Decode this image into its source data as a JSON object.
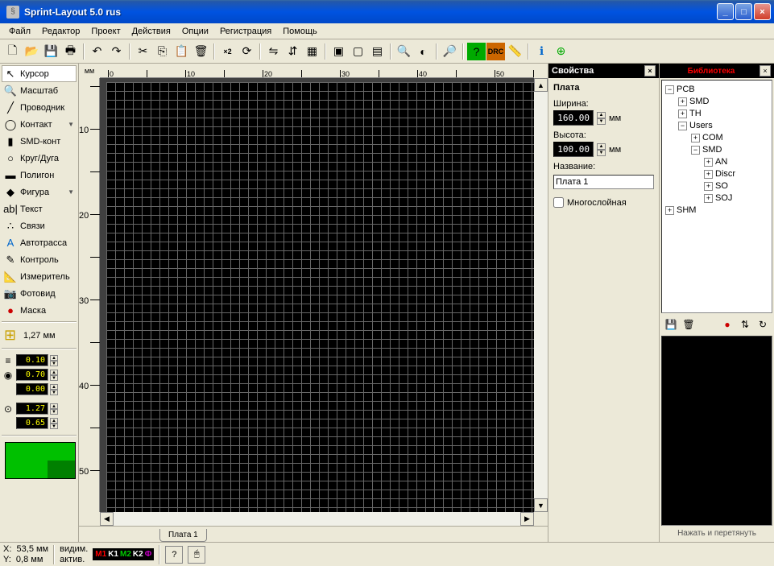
{
  "window": {
    "title": "Sprint-Layout 5.0 rus"
  },
  "menu": [
    "Файл",
    "Редактор",
    "Проект",
    "Действия",
    "Опции",
    "Регистрация",
    "Помощь"
  ],
  "toolbar": [
    {
      "name": "new-icon",
      "glyph": "🗋"
    },
    {
      "name": "open-icon",
      "glyph": "📂"
    },
    {
      "name": "save-icon",
      "glyph": "💾"
    },
    {
      "name": "print-icon",
      "glyph": "🖶"
    },
    {
      "sep": true
    },
    {
      "name": "undo-icon",
      "glyph": "↶"
    },
    {
      "name": "redo-icon",
      "glyph": "↷"
    },
    {
      "sep": true
    },
    {
      "name": "cut-icon",
      "glyph": "✂"
    },
    {
      "name": "copy-icon",
      "glyph": "⎘"
    },
    {
      "name": "paste-icon",
      "glyph": "📋"
    },
    {
      "name": "delete-icon",
      "glyph": "🗑"
    },
    {
      "sep": true
    },
    {
      "name": "duplicate-icon",
      "glyph": "×2"
    },
    {
      "name": "rotate-icon",
      "glyph": "⟳"
    },
    {
      "sep": true
    },
    {
      "name": "mirror-h-icon",
      "glyph": "⇋"
    },
    {
      "name": "mirror-v-icon",
      "glyph": "⇵"
    },
    {
      "name": "align-icon",
      "glyph": "▦"
    },
    {
      "sep": true
    },
    {
      "name": "group-icon",
      "glyph": "▣"
    },
    {
      "name": "ungroup-icon",
      "glyph": "▢"
    },
    {
      "name": "tile-icon",
      "glyph": "▤"
    },
    {
      "sep": true
    },
    {
      "name": "zoom-icon",
      "glyph": "🔍"
    },
    {
      "name": "contrast-icon",
      "glyph": "◐"
    },
    {
      "sep": true
    },
    {
      "name": "scan-icon",
      "glyph": "🔎"
    },
    {
      "sep": true
    },
    {
      "name": "help-icon",
      "glyph": "?",
      "bg": "#0a0"
    },
    {
      "name": "drc-icon",
      "glyph": "DRC",
      "bg": "#c60"
    },
    {
      "name": "measure-tool-icon",
      "glyph": "📏"
    },
    {
      "sep": true
    },
    {
      "name": "info-icon",
      "glyph": "ℹ",
      "color": "#06c"
    },
    {
      "name": "component-icon",
      "glyph": "⊕",
      "color": "#0a0"
    }
  ],
  "tools": [
    {
      "name": "cursor-tool",
      "icon": "↖",
      "label": "Курсор",
      "selected": true
    },
    {
      "name": "zoom-tool",
      "icon": "🔍",
      "label": "Масштаб"
    },
    {
      "name": "track-tool",
      "icon": "╱",
      "label": "Проводник"
    },
    {
      "name": "pad-tool",
      "icon": "◯",
      "label": "Контакт",
      "dropdown": true
    },
    {
      "name": "smd-tool",
      "icon": "▮",
      "label": "SMD-конт"
    },
    {
      "name": "circle-tool",
      "icon": "○",
      "label": "Круг/Дуга"
    },
    {
      "name": "polygon-tool",
      "icon": "▬",
      "label": "Полигон"
    },
    {
      "name": "shape-tool",
      "icon": "◆",
      "label": "Фигура",
      "dropdown": true
    },
    {
      "name": "text-tool",
      "icon": "ab|",
      "label": "Текст"
    },
    {
      "name": "connection-tool",
      "icon": "∴",
      "label": "Связи"
    },
    {
      "name": "autoroute-tool",
      "icon": "A",
      "label": "Автотрасса",
      "color": "#06c"
    },
    {
      "name": "inspect-tool",
      "icon": "✎",
      "label": "Контроль"
    },
    {
      "name": "ruler-tool",
      "icon": "📐",
      "label": "Измеритель"
    },
    {
      "name": "photoview-tool",
      "icon": "📷",
      "label": "Фотовид"
    },
    {
      "name": "mask-tool",
      "icon": "●",
      "label": "Маска",
      "color": "#c00"
    }
  ],
  "grid": {
    "label": "1,27 мм"
  },
  "params": {
    "track_width": "0.10",
    "pad_outer": "0.70",
    "pad_inner": "0.00",
    "via_a": "1.27",
    "via_b": "0.65"
  },
  "ruler": {
    "unit": "мм",
    "h_ticks": [
      "0",
      "",
      "10",
      "",
      "20",
      "",
      "30",
      "",
      "40",
      "",
      "50",
      ""
    ],
    "v_ticks": [
      "",
      "10",
      "",
      "20",
      "",
      "30",
      "",
      "40",
      "",
      "50"
    ]
  },
  "tabs": {
    "board1": "Плата 1"
  },
  "properties": {
    "panel_title": "Свойства",
    "heading": "Плата",
    "width_label": "Ширина:",
    "width_value": "160.00",
    "height_label": "Высота:",
    "height_value": "100.00",
    "unit": "мм",
    "name_label": "Название:",
    "name_value": "Плата 1",
    "multilayer_label": "Многослойная"
  },
  "library": {
    "panel_title": "Библиотека",
    "tree": {
      "PCB": {
        "exp": true,
        "children": {
          "SMD": {
            "exp": false
          },
          "TH": {
            "exp": false
          },
          "Users": {
            "exp": true,
            "children": {
              "COM": {
                "exp": false
              },
              "SMD": {
                "exp": true,
                "children": {
                  "AN": {},
                  "Discr": {},
                  "SO": {},
                  "SOJ": {}
                }
              }
            }
          }
        }
      },
      "SHM": {
        "exp": false
      }
    },
    "toolbar": [
      {
        "name": "lib-save-icon",
        "glyph": "💾"
      },
      {
        "name": "lib-delete-icon",
        "glyph": "🗑"
      },
      {
        "name": "lib-record-icon",
        "glyph": "●",
        "color": "#c00"
      },
      {
        "name": "lib-sort-icon",
        "glyph": "⇅"
      },
      {
        "name": "lib-refresh-icon",
        "glyph": "↻"
      }
    ],
    "hint": "Нажать и перетянуть"
  },
  "status": {
    "x_label": "X:",
    "x_value": "53,5 мм",
    "y_label": "Y:",
    "y_value": "0,8 мм",
    "visible_label": "видим.",
    "active_label": "актив.",
    "layers": [
      {
        "name": "M1",
        "color": "#f00"
      },
      {
        "name": "K1",
        "color": "#fff"
      },
      {
        "name": "M2",
        "color": "#0c0"
      },
      {
        "name": "K2",
        "color": "#fff"
      },
      {
        "name": "Ф",
        "color": "#c0c"
      }
    ],
    "question": "?"
  }
}
